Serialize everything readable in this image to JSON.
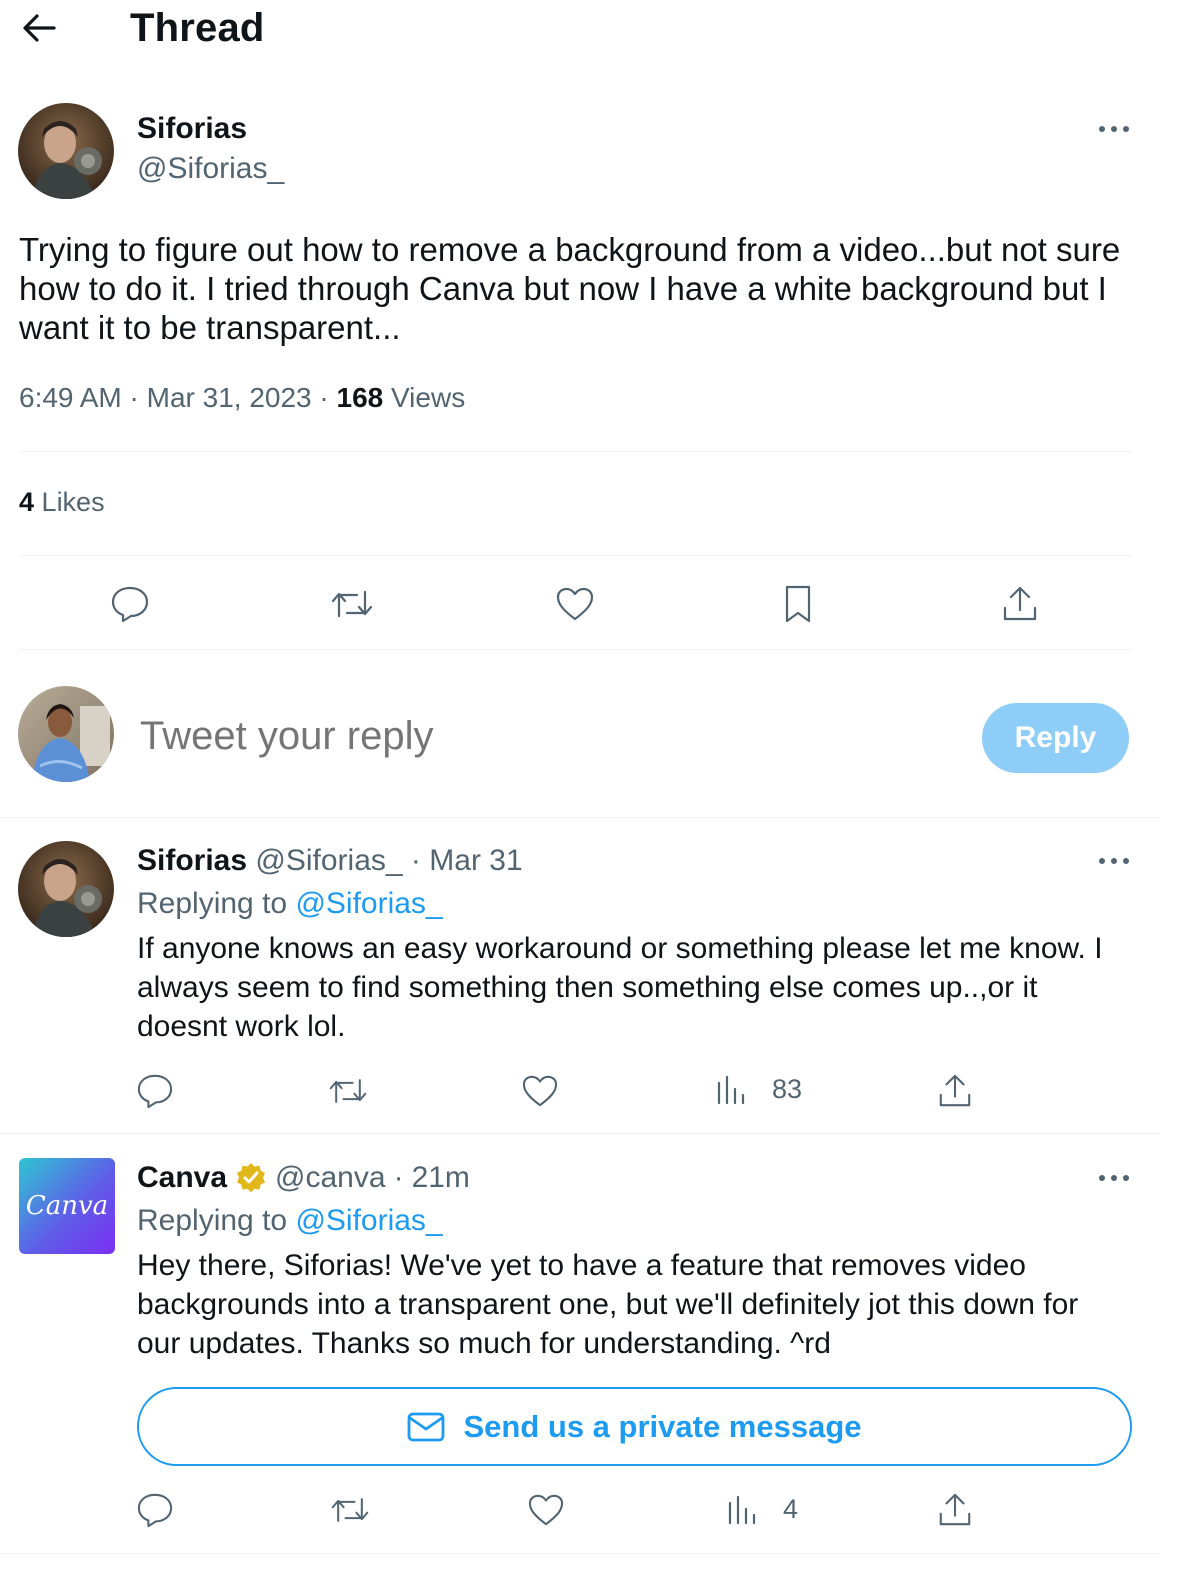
{
  "header": {
    "title": "Thread",
    "back_icon": "arrow-left-icon"
  },
  "main_tweet": {
    "name": "Siforias",
    "handle": "@Siforias_",
    "text": "Trying to figure out how to remove a background from a video...but not sure how to do it. I tried through Canva but now I have a white background but I want it to be transparent...",
    "time": "6:49 AM",
    "date": "Mar 31, 2023",
    "views_count": "168",
    "views_label": "Views",
    "likes_count": "4",
    "likes_label": "Likes",
    "sep": "·",
    "more": "more-icon"
  },
  "composer": {
    "placeholder": "Tweet your reply",
    "button": "Reply"
  },
  "replies": [
    {
      "name": "Siforias",
      "handle": "@Siforias_",
      "sep": "·",
      "time": "Mar 31",
      "replying_label": "Replying to",
      "replying_to": "@Siforias_",
      "text": "If anyone knows an easy workaround or something please let me know. I always seem to find something then something else comes up..,or it doesnt work lol.",
      "views": "83"
    },
    {
      "name": "Canva",
      "verified": true,
      "handle": "@canva",
      "sep": "·",
      "time": "21m",
      "avatar_text": "Canva",
      "replying_label": "Replying to",
      "replying_to": "@Siforias_",
      "text": "Hey there, Siforias! We've yet to have a feature that removes video backgrounds into a transparent one, but we'll definitely jot this down for our updates. Thanks so much for understanding. ^rd",
      "dm_button": "Send us a private message",
      "views": "4"
    }
  ],
  "colors": {
    "accent": "#1d9bf0",
    "reply_button": "#8ecdf8",
    "secondary_text": "#536471",
    "divider": "#eff3f4",
    "verified_gold": "#e2b719"
  }
}
